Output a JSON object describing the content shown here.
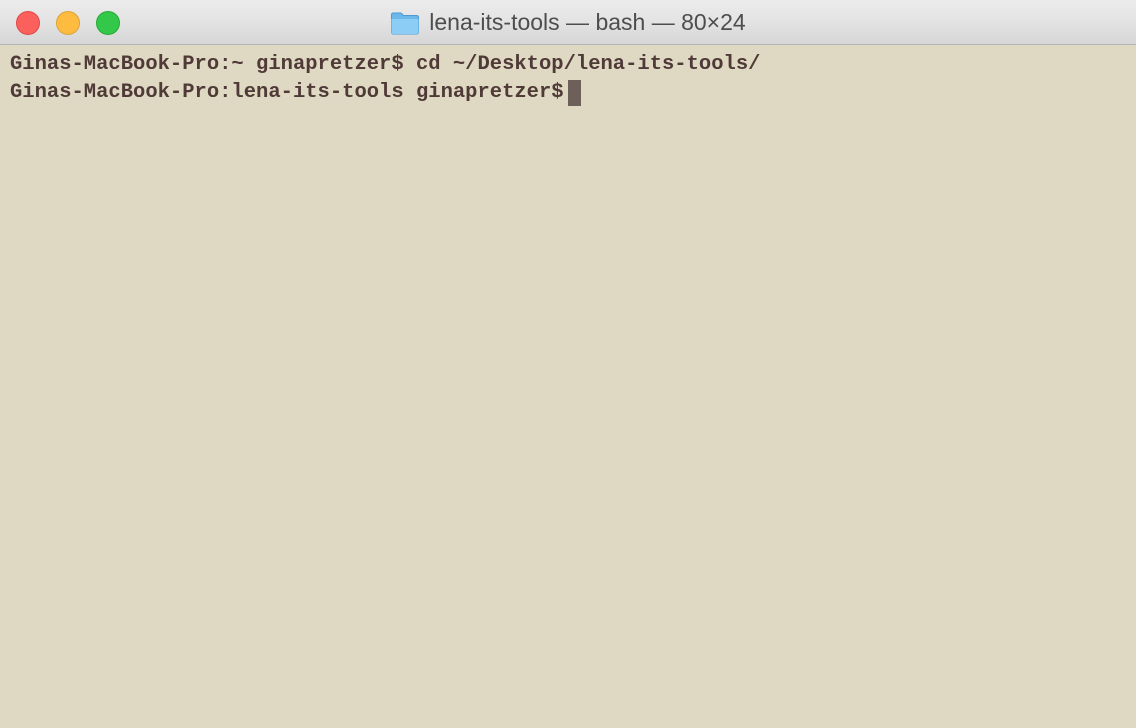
{
  "window": {
    "title": "lena-its-tools — bash — 80×24",
    "title_icon": "folder-icon",
    "controls": [
      "close",
      "minimize",
      "maximize"
    ]
  },
  "terminal": {
    "lines": [
      "Ginas-MacBook-Pro:~ ginapretzer$ cd ~/Desktop/lena-its-tools/",
      "Ginas-MacBook-Pro:lena-its-tools ginapretzer$"
    ],
    "background": "#dfd9c3",
    "foreground": "#4f3a37",
    "cursor_color": "#6e5f58"
  }
}
